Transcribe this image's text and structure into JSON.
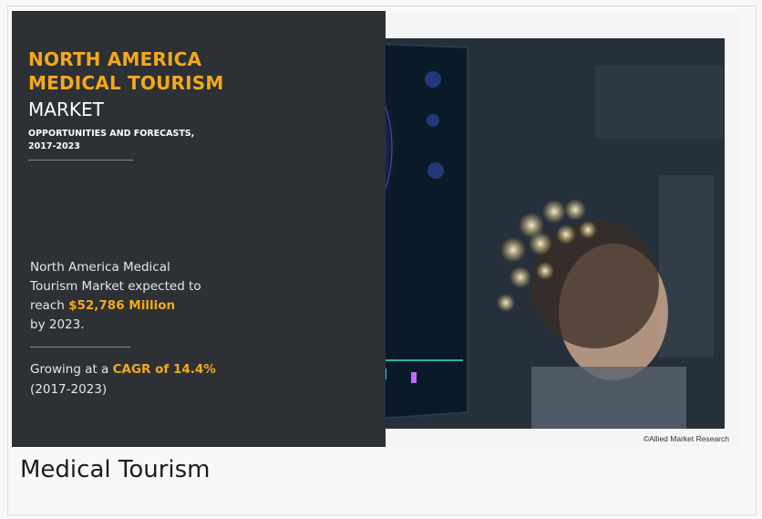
{
  "banner": {
    "title_line1": "NORTH AMERICA",
    "title_line2": "MEDICAL TOURISM",
    "title_line3": "MARKET",
    "subtitle_line1": "OPPORTUNITIES AND FORECASTS,",
    "subtitle_line2": "2017-2023",
    "market_line1": "North America Medical",
    "market_line2": "Tourism Market expected to",
    "market_line3_prefix": "reach ",
    "market_value": "$52,786 Million",
    "market_line4": "by 2023.",
    "growth_prefix": "Growing at a ",
    "growth_value": "CAGR of 14.4%",
    "growth_period": "(2017-2023)",
    "credit": "©Allied Market Research"
  },
  "caption": "Medical Tourism",
  "colors": {
    "accent": "#f4a81c",
    "panel": "#2d3135"
  }
}
